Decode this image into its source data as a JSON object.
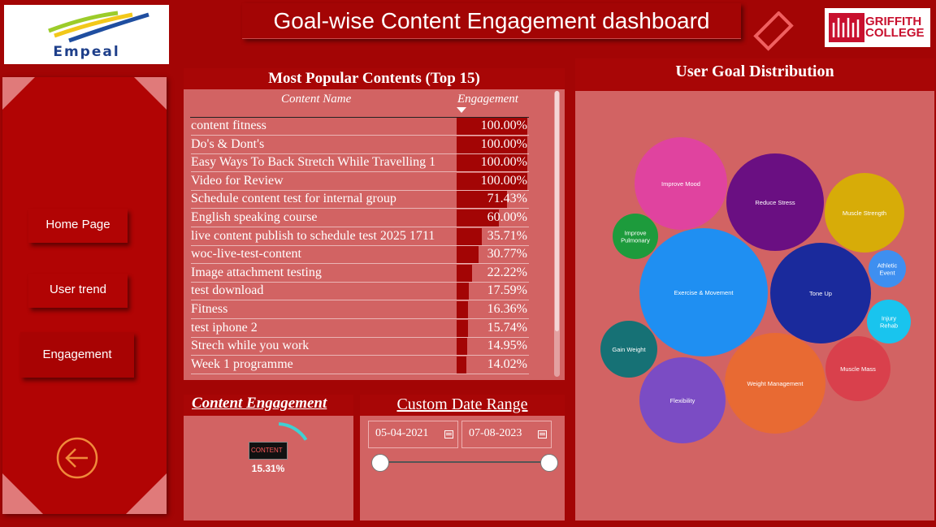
{
  "header": {
    "title": "Goal-wise Content Engagement dashboard"
  },
  "logos": {
    "left": "Empeal",
    "right_line1": "GRIFFITH",
    "right_line2": "COLLEGE"
  },
  "nav": {
    "items": [
      {
        "label": "Home Page"
      },
      {
        "label": "User trend"
      },
      {
        "label": "Engagement"
      }
    ]
  },
  "popular": {
    "title": "Most Popular Contents (Top 15)",
    "col_name": "Content Name",
    "col_value": "Engagement",
    "rows": [
      {
        "name": "content fitness",
        "value": "100.00%",
        "pct": 100
      },
      {
        "name": "Do's & Dont's",
        "value": "100.00%",
        "pct": 100
      },
      {
        "name": "Easy Ways To Back Stretch While Travelling 1",
        "value": "100.00%",
        "pct": 100
      },
      {
        "name": "Video for Review",
        "value": "100.00%",
        "pct": 100
      },
      {
        "name": "Schedule content test for internal group",
        "value": "71.43%",
        "pct": 71.43
      },
      {
        "name": "English speaking course",
        "value": "60.00%",
        "pct": 60
      },
      {
        "name": "live content publish to schedule test 2025 1711",
        "value": "35.71%",
        "pct": 35.71
      },
      {
        "name": "woc-live-test-content",
        "value": "30.77%",
        "pct": 30.77
      },
      {
        "name": "Image attachment testing",
        "value": "22.22%",
        "pct": 22.22
      },
      {
        "name": "test download",
        "value": "17.59%",
        "pct": 17.59
      },
      {
        "name": "Fitness",
        "value": "16.36%",
        "pct": 16.36
      },
      {
        "name": "test iphone 2",
        "value": "15.74%",
        "pct": 15.74
      },
      {
        "name": "Strech while you work",
        "value": "14.95%",
        "pct": 14.95
      },
      {
        "name": "Week 1 programme",
        "value": "14.02%",
        "pct": 14.02
      }
    ]
  },
  "engagement_card": {
    "title": "Content Engagement",
    "icon_text": "CONTENT",
    "value": "15.31%",
    "gauge_fraction": 0.1531
  },
  "date_range": {
    "title": "Custom Date Range",
    "start": "05-04-2021",
    "end": "07-08-2023",
    "slider_start": 0,
    "slider_end": 1
  },
  "goals": {
    "title": "User Goal Distribution",
    "bubbles": [
      {
        "label": "Improve Mood",
        "color": "#e0439f"
      },
      {
        "label": "Reduce Stress",
        "color": "#6a0f82"
      },
      {
        "label": "Muscle Strength",
        "color": "#d7ac08"
      },
      {
        "label": "Improve Pulmonary",
        "color": "#1d9b3c"
      },
      {
        "label": "Athletic Event",
        "color": "#3e8ff0"
      },
      {
        "label": "Exercise & Movement",
        "color": "#1f8ff2"
      },
      {
        "label": "Tone Up",
        "color": "#1a2a9c"
      },
      {
        "label": "Injury Rehab",
        "color": "#19c4ee"
      },
      {
        "label": "Gain Weight",
        "color": "#167175"
      },
      {
        "label": "Muscle Mass",
        "color": "#d9404c"
      },
      {
        "label": "Weight Management",
        "color": "#e86a33"
      },
      {
        "label": "Flexibility",
        "color": "#7b4cc4"
      }
    ]
  }
}
